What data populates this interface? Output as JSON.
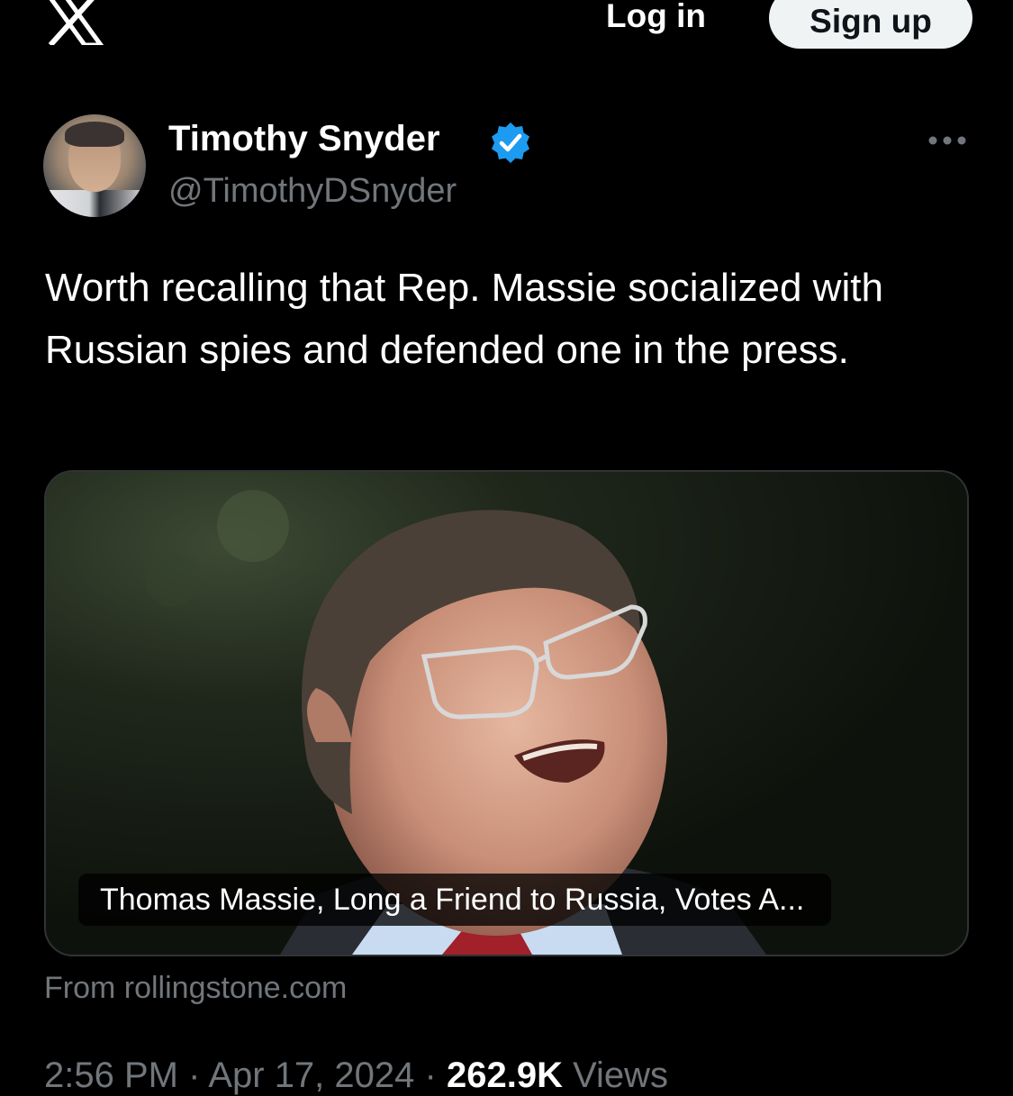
{
  "header": {
    "logo": "x-logo",
    "login_label": "Log in",
    "signup_label": "Sign up"
  },
  "tweet": {
    "author_name": "Timothy Snyder",
    "author_handle": "@TimothyDSnyder",
    "verified": true,
    "text": "Worth recalling that Rep. Massie socialized with Russian spies and defended one in the press.",
    "card": {
      "title": "Thomas Massie, Long a Friend to Russia, Votes A...",
      "source": "From rollingstone.com"
    },
    "time": "2:56 PM",
    "separator": "·",
    "date": "Apr 17, 2024",
    "views_count": "262.9K",
    "views_label": "Views"
  },
  "colors": {
    "background": "#000000",
    "primary_text": "#ffffff",
    "secondary_text": "#71767b",
    "verified_blue": "#1d9bf0",
    "button_bg": "#eff3f4"
  }
}
